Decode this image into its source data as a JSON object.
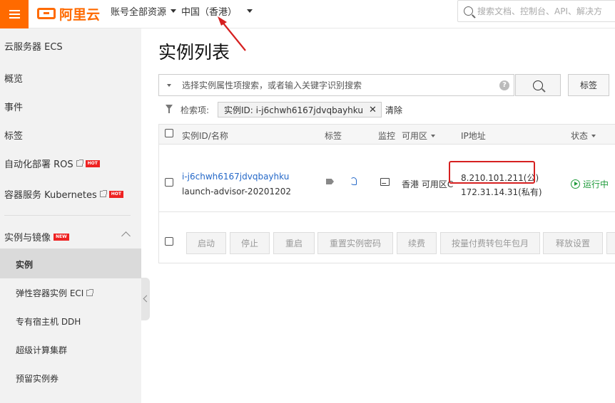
{
  "topbar": {
    "logo_text": "阿里云",
    "account_scope": "账号全部资源",
    "region": "中国（香港）",
    "search_placeholder": "搜索文档、控制台、API、解决方"
  },
  "sidebar": {
    "title": "云服务器 ECS",
    "items": [
      {
        "label": "概览"
      },
      {
        "label": "事件"
      },
      {
        "label": "标签"
      },
      {
        "label": "自动化部署 ROS",
        "badge": "HOT"
      },
      {
        "label": "容器服务 Kubernetes",
        "badge": "HOT"
      }
    ],
    "section": {
      "label": "实例与镜像",
      "badge": "NEW"
    },
    "sub_items": [
      {
        "label": "实例"
      },
      {
        "label": "弹性容器实例 ECI"
      },
      {
        "label": "专有宿主机 DDH"
      },
      {
        "label": "超级计算集群"
      },
      {
        "label": "预留实例券"
      }
    ]
  },
  "main": {
    "title": "实例列表",
    "filter_placeholder": "选择实例属性项搜索，或者输入关键字识别搜索",
    "tag_button": "标签",
    "criteria_label": "检索项:",
    "criteria_chip": "实例ID: i-j6chwh6167jdvqbayhku",
    "clear": "清除"
  },
  "table": {
    "headers": {
      "id_name": "实例ID/名称",
      "tags": "标签",
      "monitor": "监控",
      "zone": "可用区",
      "ip": "IP地址",
      "status": "状态"
    },
    "row": {
      "id": "i-j6chwh6167jdvqbayhku",
      "name": "launch-advisor-20201202",
      "zone": "香港 可用区C",
      "public_ip": "8.210.101.211(公)",
      "private_ip": "172.31.14.31(私有)",
      "status": "运行中"
    },
    "actions": [
      "启动",
      "停止",
      "重启",
      "重置实例密码",
      "续费",
      "按量付费转包年包月",
      "释放设置"
    ]
  },
  "colors": {
    "brand": "#ff6a00",
    "link": "#2468c8",
    "running": "#1e9b3a",
    "annotation": "#d62020"
  }
}
